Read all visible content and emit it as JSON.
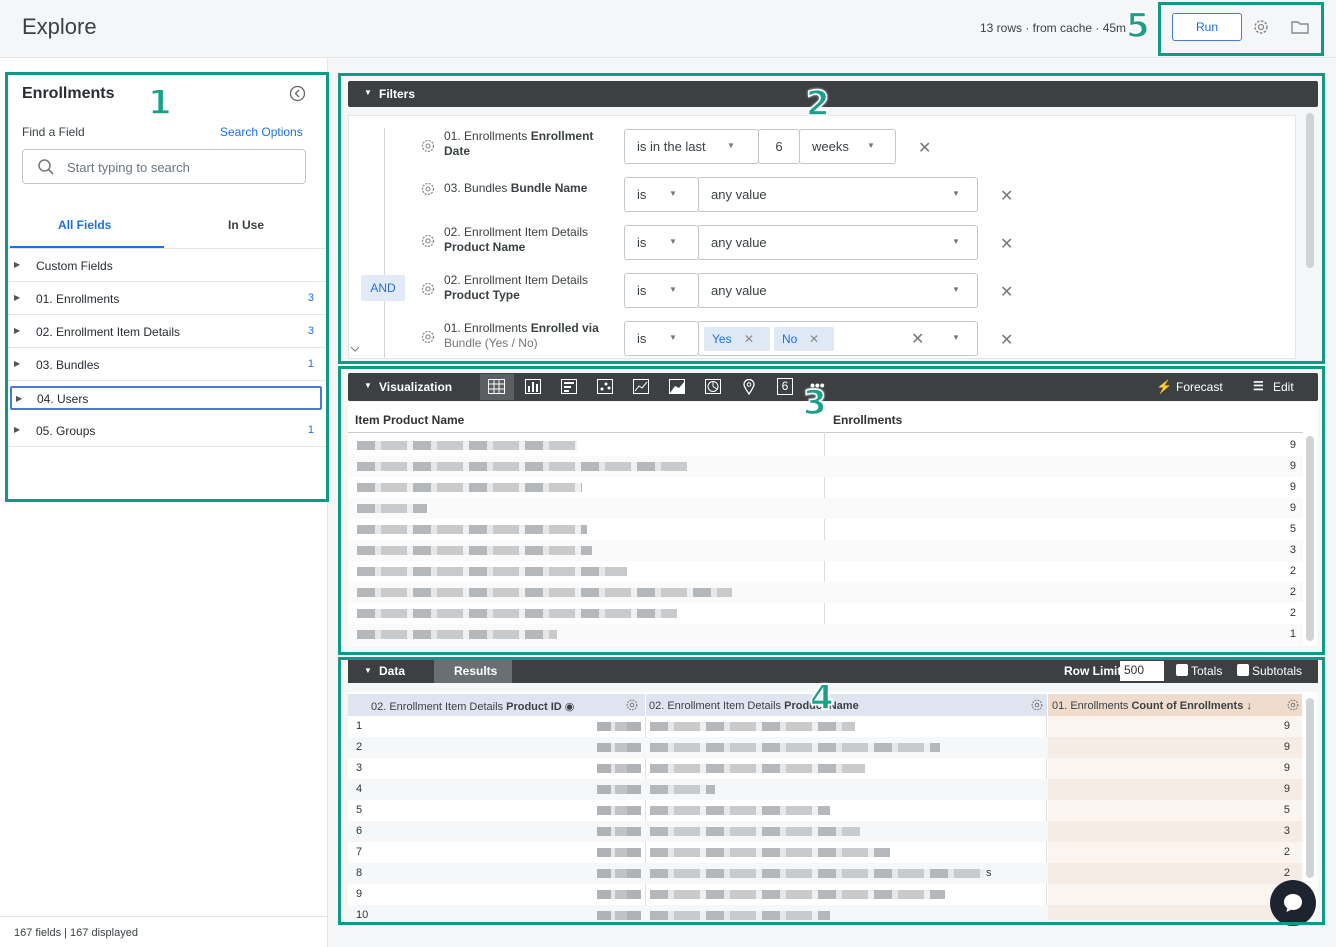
{
  "header": {
    "title": "Explore",
    "status": "13 rows · from cache · 45m",
    "run_label": "Run"
  },
  "sidebar": {
    "title": "Enrollments",
    "find_label": "Find a Field",
    "search_options": "Search Options",
    "search_placeholder": "Start typing to search",
    "tabs": [
      "All Fields",
      "In Use"
    ],
    "items": [
      {
        "label": "Custom Fields",
        "count": ""
      },
      {
        "label": "01. Enrollments",
        "count": "3"
      },
      {
        "label": "02. Enrollment Item Details",
        "count": "3"
      },
      {
        "label": "03. Bundles",
        "count": "1"
      },
      {
        "label": "04. Users",
        "count": ""
      },
      {
        "label": "05. Groups",
        "count": "1"
      }
    ],
    "footer": "167 fields | 167 displayed"
  },
  "filters": {
    "title": "Filters",
    "and_label": "AND",
    "rows": [
      {
        "name_light": "01. Enrollments ",
        "name_bold": "Enrollment Date",
        "op": "is in the last",
        "value": "6",
        "unit": "weeks"
      },
      {
        "name_light": "03. Bundles ",
        "name_bold": "Bundle Name",
        "op": "is",
        "value": "any value"
      },
      {
        "name_light": "02. Enrollment Item Details ",
        "name_bold": "Product Name",
        "op": "is",
        "value": "any value"
      },
      {
        "name_light": "02. Enrollment Item Details ",
        "name_bold": "Product Type",
        "op": "is",
        "value": "any value"
      },
      {
        "name_light": "01. Enrollments ",
        "name_bold": "Enrolled via",
        "name_extra": "Bundle (Yes / No)",
        "op": "is",
        "chips": [
          "Yes",
          "No"
        ]
      }
    ]
  },
  "visualization": {
    "title": "Visualization",
    "forecast": "Forecast",
    "edit": "Edit",
    "single_value_icon": "6",
    "col1": "Item Product Name",
    "col2": "Enrollments",
    "values": [
      "9",
      "9",
      "9",
      "9",
      "5",
      "3",
      "2",
      "2",
      "2",
      "1"
    ]
  },
  "data_panel": {
    "tab_data": "Data",
    "tab_results": "Results",
    "row_limit_label": "Row Limit",
    "row_limit": "500",
    "totals": "Totals",
    "subtotals": "Subtotals",
    "col1_light": "02. Enrollment Item Details ",
    "col1_bold": "Product ID",
    "col2_light": "02. Enrollment Item Details ",
    "col2_bold": "Product Name",
    "col3_light": "01. Enrollments ",
    "col3_bold": "Count of Enrollments",
    "row_numbers": [
      "1",
      "2",
      "3",
      "4",
      "5",
      "6",
      "7",
      "8",
      "9",
      "10"
    ],
    "counts": [
      "9",
      "9",
      "9",
      "9",
      "5",
      "3",
      "2",
      "2",
      "2",
      ""
    ],
    "row8_suffix": "s"
  },
  "annotations": [
    "1",
    "2",
    "3",
    "4",
    "5"
  ],
  "colors": {
    "highlight": "#0f9a87",
    "accent": "#1a73e8",
    "dark_bar": "#3c4043"
  }
}
